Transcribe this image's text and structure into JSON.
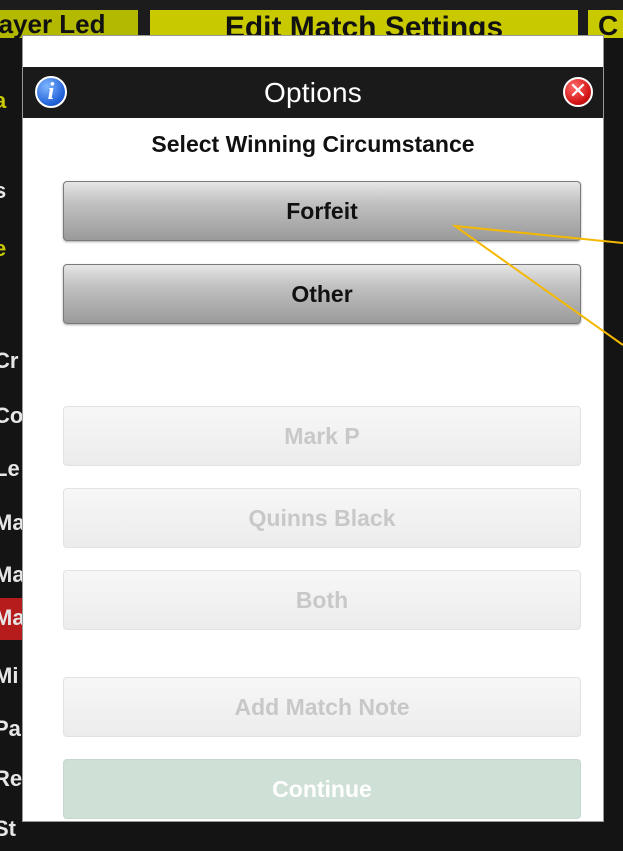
{
  "background": {
    "left_tab": "Player Led",
    "title": "Edit Match Settings",
    "right_tab": "C",
    "left_edge_letters": [
      "a",
      "s",
      "e",
      "Cr",
      "Co",
      "Le",
      "Ma",
      "Ma",
      "Ma",
      "Mi",
      "Pa",
      "Re",
      "St"
    ],
    "right_edge_letters": [
      "",
      "",
      "",
      "",
      "",
      "",
      "",
      "",
      "",
      "",
      "",
      "",
      ""
    ]
  },
  "modal": {
    "title": "Options",
    "info_glyph": "i",
    "close_glyph": "✕",
    "subtitle": "Select Winning Circumstance",
    "options": {
      "forfeit": "Forfeit",
      "other": "Other",
      "player1": "Mark P",
      "player2": "Quinns Black",
      "both": "Both",
      "note": "Add Match Note",
      "continue": "Continue"
    }
  },
  "colors": {
    "header_bg": "#1a1a1a",
    "annotation_line": "#f5b800",
    "continue_bg": "#cfe0d6",
    "background_accent": "#c9c900"
  }
}
